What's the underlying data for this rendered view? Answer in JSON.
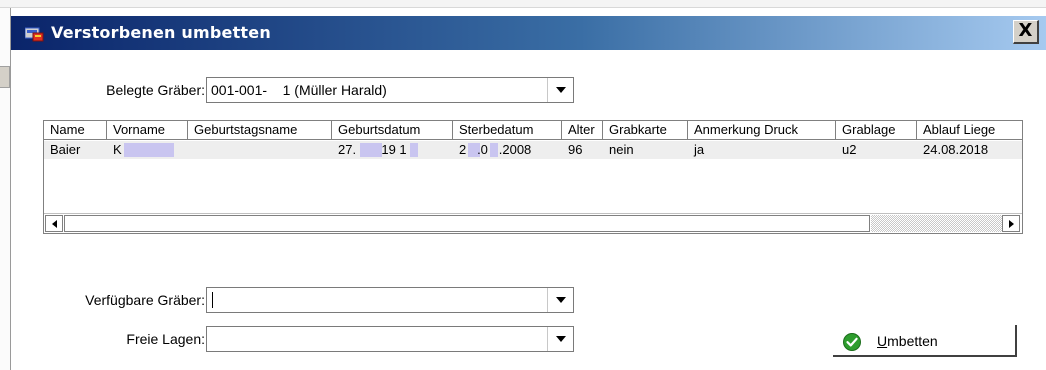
{
  "window": {
    "title": "Verstorbenen umbetten",
    "close_label": "X"
  },
  "belegte": {
    "label": "Belegte Gräber:",
    "value": "001-001-    1 (Müller Harald)"
  },
  "grid": {
    "columns": [
      "Name",
      "Vorname",
      "Geburtstagsname",
      "Geburtsdatum",
      "Sterbedatum",
      "Alter",
      "Grabkarte",
      "Anmerkung Druck",
      "Grablage",
      "Ablauf Liege"
    ],
    "rows": [
      {
        "name": "Baier",
        "vorname": "K",
        "geburtstagsname": "",
        "geburtsdatum": "27.       19 1",
        "sterbedatum": "2   .0   .2008",
        "alter": "96",
        "grabkarte": "nein",
        "anmerkung_druck": "ja",
        "grablage": "u2",
        "ablauf_liege": "24.08.2018"
      }
    ]
  },
  "verfuegbare": {
    "label": "Verfügbare Gräber:",
    "value": ""
  },
  "freie": {
    "label": "Freie Lagen:",
    "value": ""
  },
  "actions": {
    "umbetten_mnemonic": "U",
    "umbetten_rest": "mbetten"
  },
  "colors": {
    "title_gradient_start": "#0a246a",
    "title_gradient_end": "#a6caf0",
    "row_highlight": "#eeeeee",
    "mask": "#c9c5f0",
    "ok_green": "#2e9d2e"
  },
  "icons": {
    "window": "app-window-icon",
    "ok": "check-circle-icon"
  }
}
